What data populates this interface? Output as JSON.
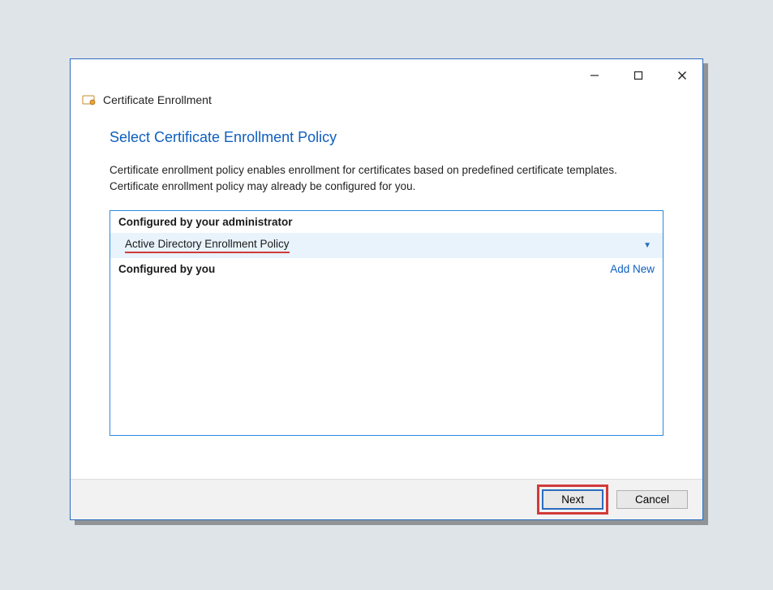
{
  "header": {
    "title": "Certificate Enrollment"
  },
  "page": {
    "title": "Select Certificate Enrollment Policy",
    "description": "Certificate enrollment policy enables enrollment for certificates based on predefined certificate templates. Certificate enrollment policy may already be configured for you."
  },
  "sections": {
    "admin_label": "Configured by your administrator",
    "user_label": "Configured by you",
    "add_new": "Add New"
  },
  "policies": {
    "admin_selected": "Active Directory Enrollment Policy"
  },
  "buttons": {
    "next": "Next",
    "cancel": "Cancel"
  }
}
